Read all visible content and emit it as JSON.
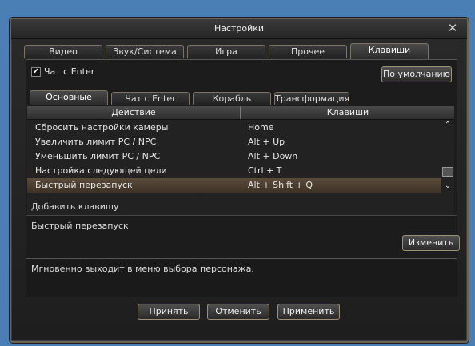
{
  "window": {
    "title": "Настройки",
    "close_glyph": "✕"
  },
  "tabs": [
    {
      "label": "Видео",
      "active": false
    },
    {
      "label": "Звук/Система",
      "active": false
    },
    {
      "label": "Игра",
      "active": false
    },
    {
      "label": "Прочее",
      "active": false
    },
    {
      "label": "Клавиши",
      "active": true
    }
  ],
  "panel": {
    "checkbox_label": "Чат с Enter",
    "checkbox_checked": true,
    "default_button": "По умолчанию"
  },
  "subtabs": [
    {
      "label": "Основные",
      "active": true
    },
    {
      "label": "Чат с Enter",
      "active": false
    },
    {
      "label": "Корабль",
      "active": false
    },
    {
      "label": "Трансформация",
      "active": false
    }
  ],
  "table": {
    "headers": [
      "Действие",
      "Клавиши"
    ],
    "rows": [
      {
        "action": "Сбросить настройки камеры",
        "keys": "Home",
        "selected": false
      },
      {
        "action": "Увеличить лимит PC / NPC",
        "keys": "Alt + Up",
        "selected": false
      },
      {
        "action": "Уменьшить лимит PC / NPC",
        "keys": "Alt + Down",
        "selected": false
      },
      {
        "action": "Настройка следующей цели",
        "keys": "Ctrl + T",
        "selected": false
      },
      {
        "action": "Быстрый перезапуск",
        "keys": "Alt + Shift + Q",
        "selected": true
      }
    ]
  },
  "add_key_label": "Добавить клавишу",
  "edit": {
    "current": "Быстрый перезапуск",
    "change_button": "Изменить"
  },
  "description": "Мгновенно выходит в меню выбора персонажа.",
  "footer": {
    "accept": "Принять",
    "cancel": "Отменить",
    "apply": "Применить"
  },
  "colors": {
    "accent_border": "#9c9278",
    "selected_row": "#5a4b3a",
    "background": "#4a7fb5"
  }
}
